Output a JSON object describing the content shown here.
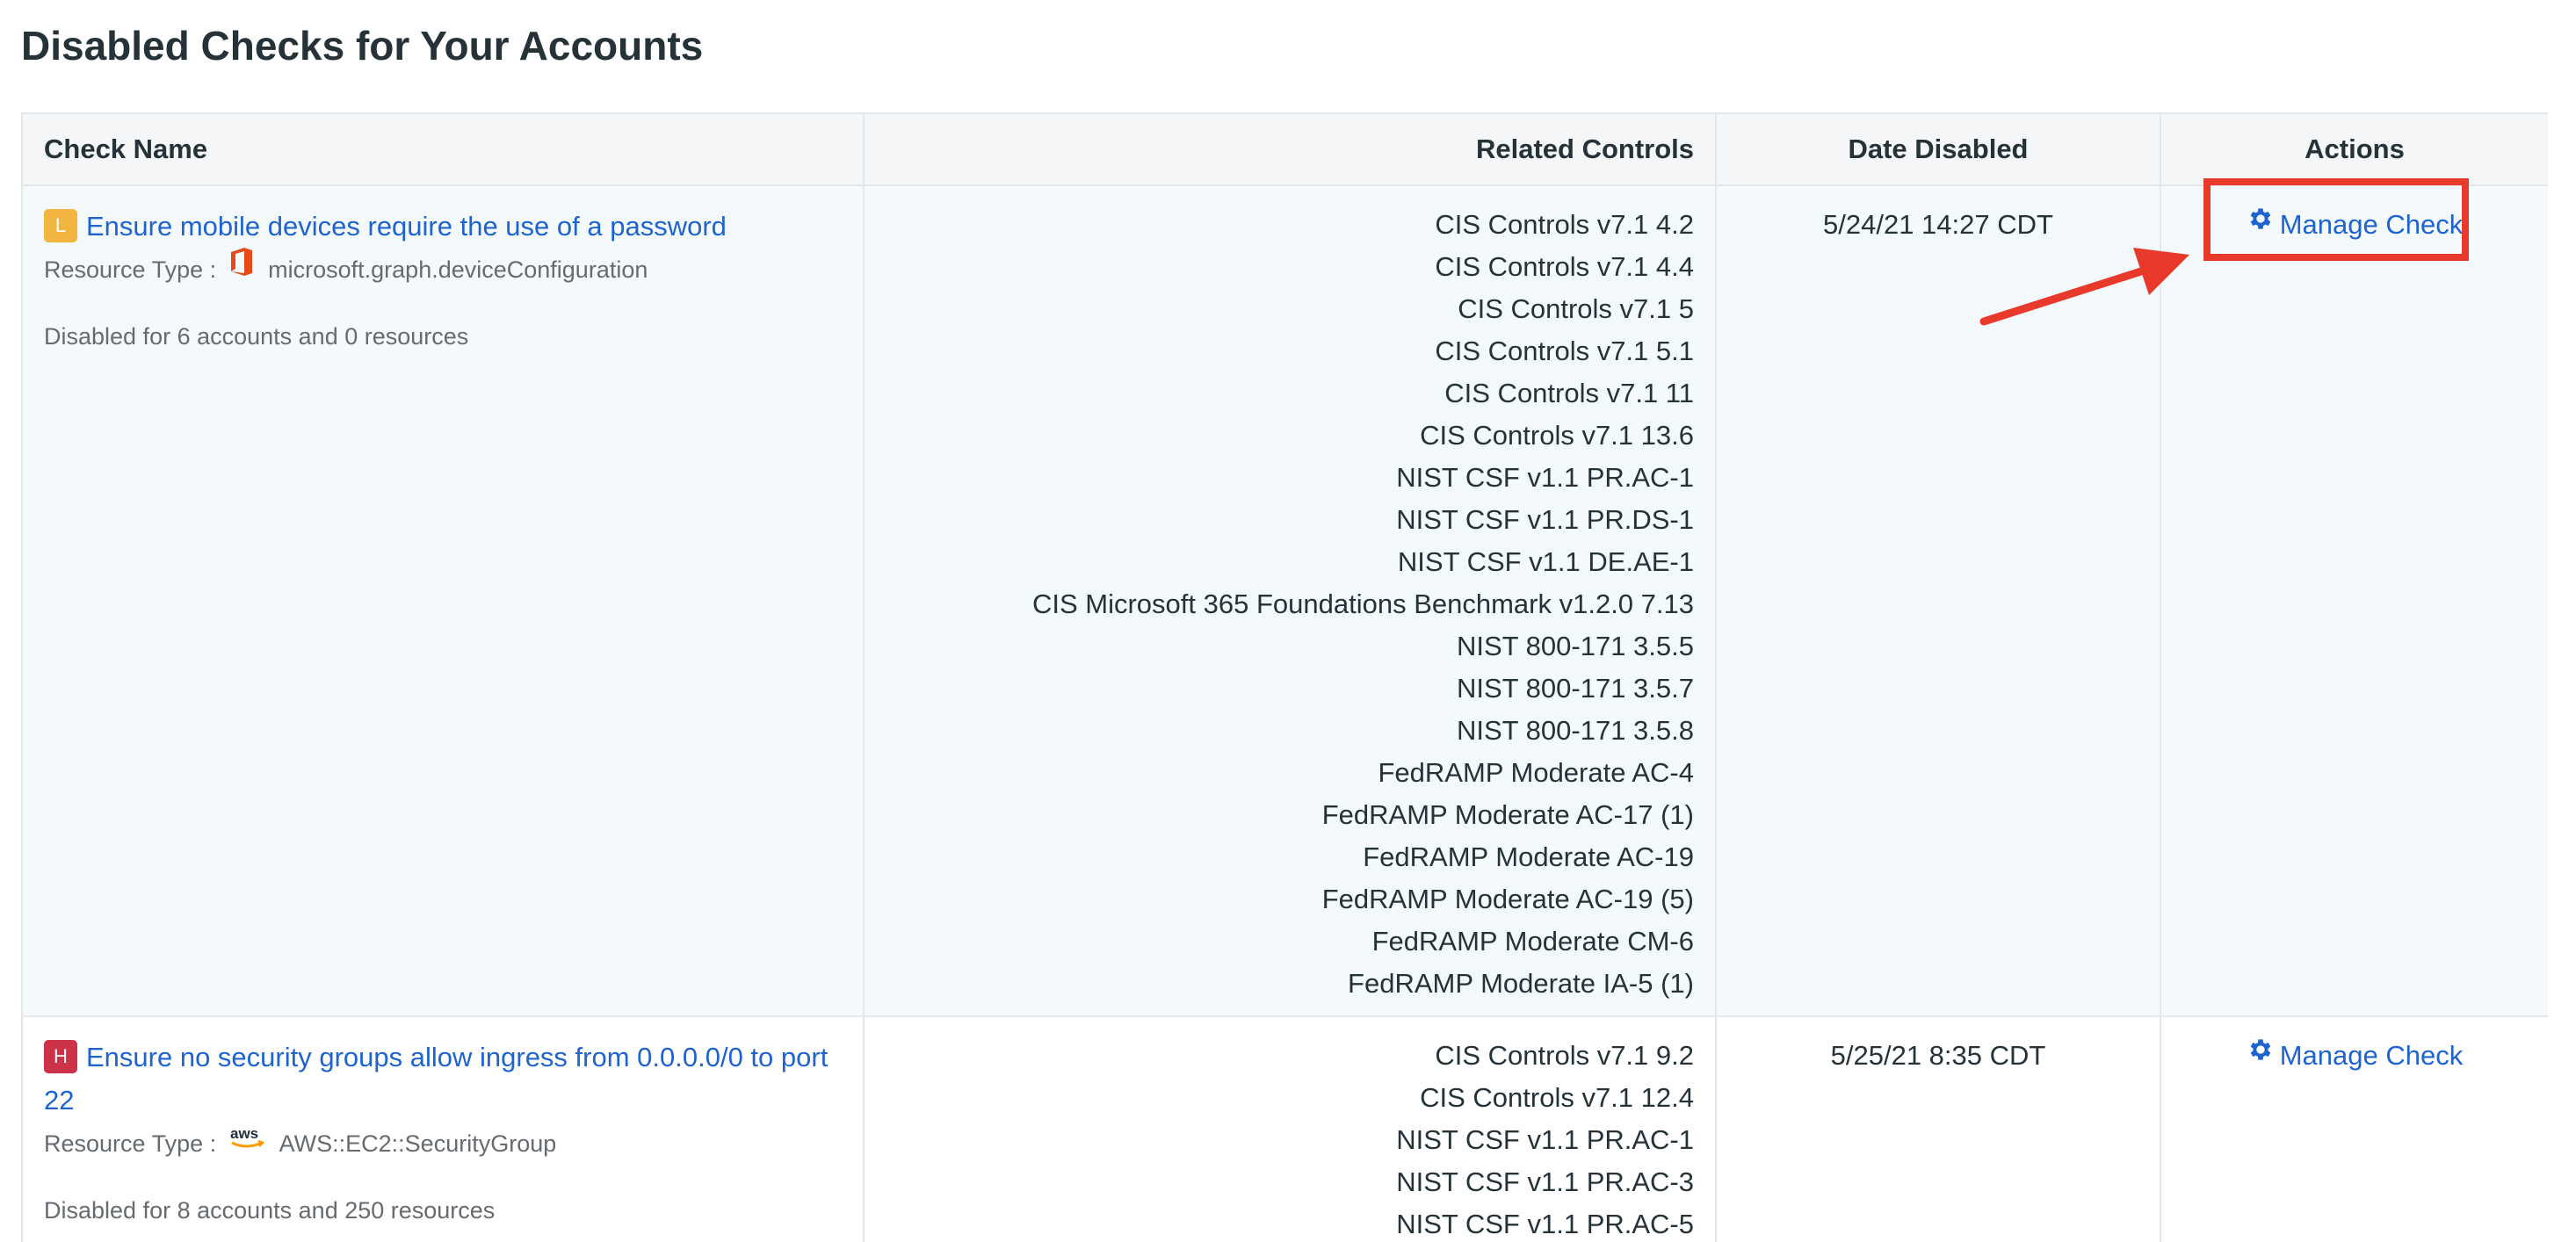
{
  "page": {
    "title": "Disabled Checks for Your Accounts"
  },
  "table": {
    "headers": {
      "check_name": "Check Name",
      "related_controls": "Related Controls",
      "date_disabled": "Date Disabled",
      "actions": "Actions"
    },
    "rows": [
      {
        "severity": "L",
        "severity_color": "#f2b640",
        "name": "Ensure mobile devices require the use of a password",
        "resource_label": "Resource Type :",
        "resource_icon": "office-icon",
        "resource_type": "microsoft.graph.deviceConfiguration",
        "disabled_summary": "Disabled for 6 accounts and 0 resources",
        "controls": [
          "CIS Controls v7.1 4.2",
          "CIS Controls v7.1 4.4",
          "CIS Controls v7.1 5",
          "CIS Controls v7.1 5.1",
          "CIS Controls v7.1 11",
          "CIS Controls v7.1 13.6",
          "NIST CSF v1.1 PR.AC-1",
          "NIST CSF v1.1 PR.DS-1",
          "NIST CSF v1.1 DE.AE-1",
          "CIS Microsoft 365 Foundations Benchmark v1.2.0 7.13",
          "NIST 800-171 3.5.5",
          "NIST 800-171 3.5.7",
          "NIST 800-171 3.5.8",
          "FedRAMP Moderate AC-4",
          "FedRAMP Moderate AC-17 (1)",
          "FedRAMP Moderate AC-19",
          "FedRAMP Moderate AC-19 (5)",
          "FedRAMP Moderate CM-6",
          "FedRAMP Moderate IA-5 (1)"
        ],
        "date_disabled": "5/24/21 14:27 CDT",
        "action_label": "Manage Check"
      },
      {
        "severity": "H",
        "severity_color": "#cc3348",
        "name": "Ensure no security groups allow ingress from 0.0.0.0/0 to port 22",
        "resource_label": "Resource Type :",
        "resource_icon": "aws-icon",
        "resource_type": "AWS::EC2::SecurityGroup",
        "aws_logo_text": "aws",
        "disabled_summary": "Disabled for 8 accounts and 250 resources",
        "controls": [
          "CIS Controls v7.1 9.2",
          "CIS Controls v7.1 12.4",
          "NIST CSF v1.1 PR.AC-1",
          "NIST CSF v1.1 PR.AC-3",
          "NIST CSF v1.1 PR.AC-5"
        ],
        "date_disabled": "5/25/21 8:35 CDT",
        "action_label": "Manage Check"
      }
    ]
  },
  "annotation": {
    "highlight_color": "#e8392a",
    "highlight_target": "Manage Check"
  }
}
